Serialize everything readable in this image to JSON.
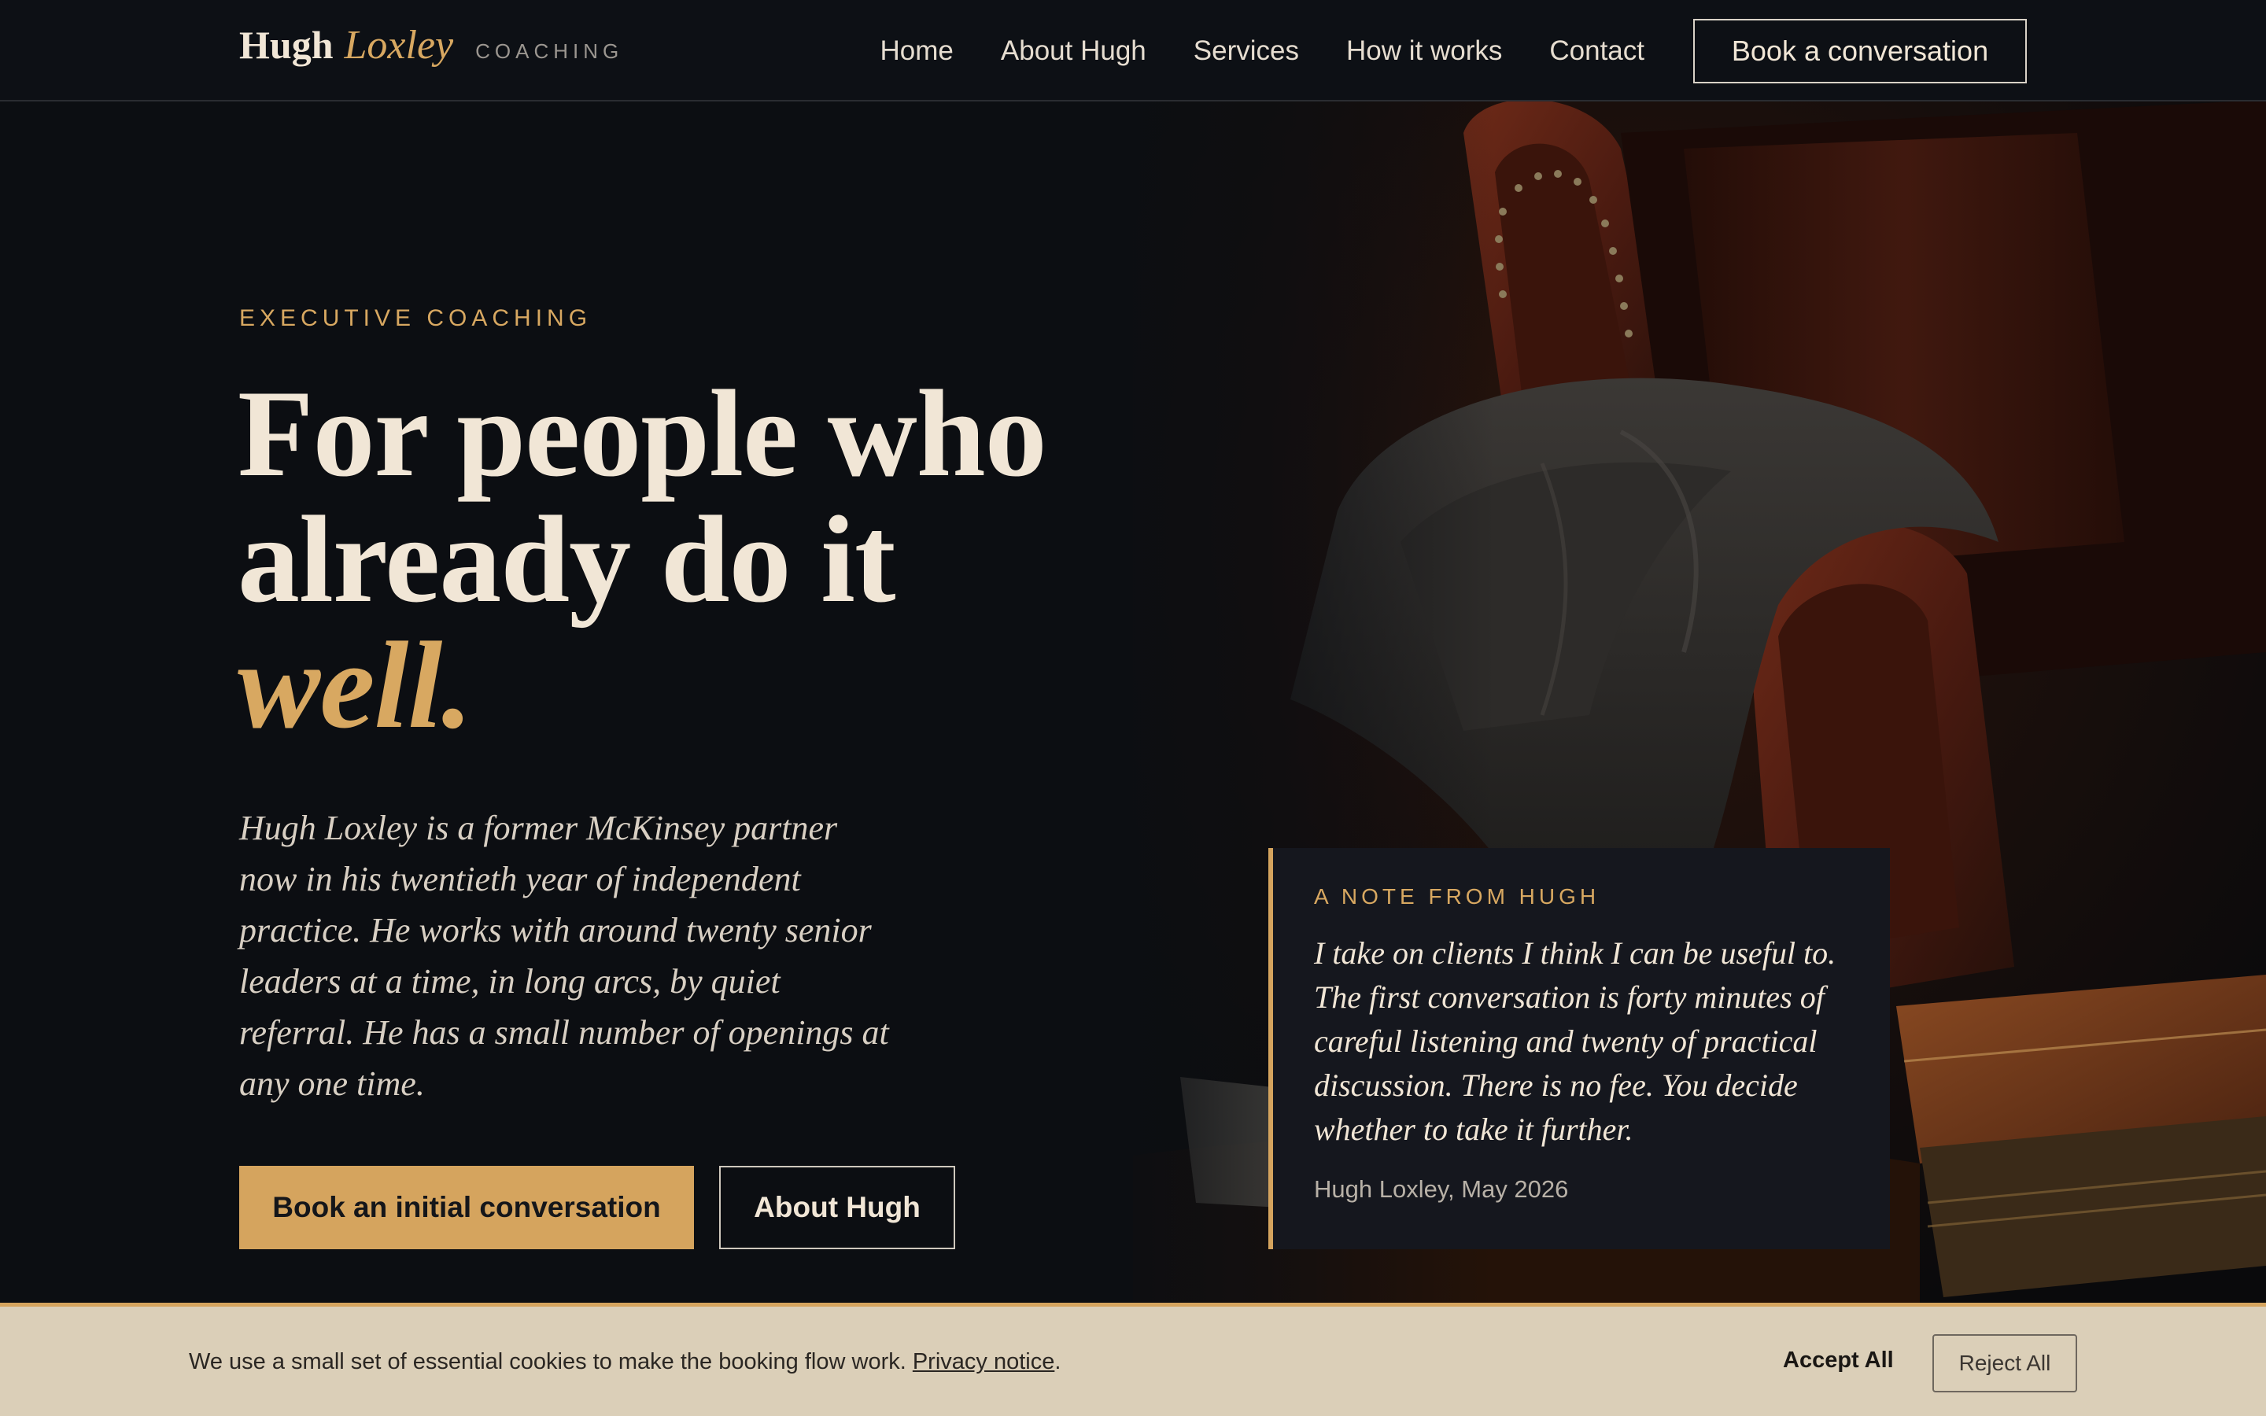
{
  "nav": {
    "brand_first": "Hugh",
    "brand_last": "Loxley",
    "brand_tag": "COACHING",
    "links": [
      "Home",
      "About Hugh",
      "Services",
      "How it works",
      "Contact"
    ],
    "cta": "Book a conversation"
  },
  "hero": {
    "eyebrow": "EXECUTIVE COACHING",
    "headline_line1": "For people who",
    "headline_line2": "already do it",
    "headline_accent": "well.",
    "lede": "Hugh Loxley is a former McKinsey partner now in his twentieth year of independent practice. He works with around twenty senior leaders at a time, in long arcs, by quiet referral. He has a small number of openings at any one time.",
    "primary_button": "Book an initial conversation",
    "secondary_button": "About Hugh"
  },
  "note": {
    "eyebrow": "A NOTE FROM HUGH",
    "body": "I take on clients I think I can be useful to. The first conversation is forty minutes of careful listening and twenty of practical discussion. There is no fee. You decide whether to take it further.",
    "signature": "Hugh Loxley, May 2026"
  },
  "cookie": {
    "text": "We use a small set of essential cookies to make the booking flow work.",
    "privacy_link": "Privacy notice",
    "period": ".",
    "accept": "Accept All",
    "reject": "Reject All"
  },
  "colors": {
    "background": "#0c0e12",
    "accent_gold": "#d5a45e",
    "cream_text": "#f1e6d6",
    "card": "#15171e",
    "cookie_bg": "#dbcfb8"
  }
}
